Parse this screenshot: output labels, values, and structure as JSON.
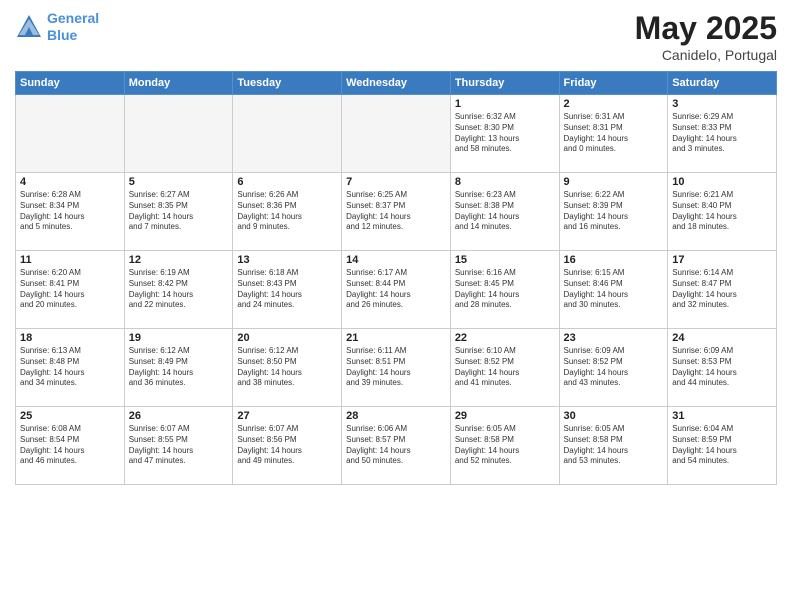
{
  "header": {
    "logo_line1": "General",
    "logo_line2": "Blue",
    "title": "May 2025",
    "subtitle": "Canidelo, Portugal"
  },
  "weekdays": [
    "Sunday",
    "Monday",
    "Tuesday",
    "Wednesday",
    "Thursday",
    "Friday",
    "Saturday"
  ],
  "weeks": [
    [
      {
        "day": "",
        "empty": true
      },
      {
        "day": "",
        "empty": true
      },
      {
        "day": "",
        "empty": true
      },
      {
        "day": "",
        "empty": true
      },
      {
        "day": "1",
        "lines": [
          "Sunrise: 6:32 AM",
          "Sunset: 8:30 PM",
          "Daylight: 13 hours",
          "and 58 minutes."
        ]
      },
      {
        "day": "2",
        "lines": [
          "Sunrise: 6:31 AM",
          "Sunset: 8:31 PM",
          "Daylight: 14 hours",
          "and 0 minutes."
        ]
      },
      {
        "day": "3",
        "lines": [
          "Sunrise: 6:29 AM",
          "Sunset: 8:33 PM",
          "Daylight: 14 hours",
          "and 3 minutes."
        ]
      }
    ],
    [
      {
        "day": "4",
        "lines": [
          "Sunrise: 6:28 AM",
          "Sunset: 8:34 PM",
          "Daylight: 14 hours",
          "and 5 minutes."
        ]
      },
      {
        "day": "5",
        "lines": [
          "Sunrise: 6:27 AM",
          "Sunset: 8:35 PM",
          "Daylight: 14 hours",
          "and 7 minutes."
        ]
      },
      {
        "day": "6",
        "lines": [
          "Sunrise: 6:26 AM",
          "Sunset: 8:36 PM",
          "Daylight: 14 hours",
          "and 9 minutes."
        ]
      },
      {
        "day": "7",
        "lines": [
          "Sunrise: 6:25 AM",
          "Sunset: 8:37 PM",
          "Daylight: 14 hours",
          "and 12 minutes."
        ]
      },
      {
        "day": "8",
        "lines": [
          "Sunrise: 6:23 AM",
          "Sunset: 8:38 PM",
          "Daylight: 14 hours",
          "and 14 minutes."
        ]
      },
      {
        "day": "9",
        "lines": [
          "Sunrise: 6:22 AM",
          "Sunset: 8:39 PM",
          "Daylight: 14 hours",
          "and 16 minutes."
        ]
      },
      {
        "day": "10",
        "lines": [
          "Sunrise: 6:21 AM",
          "Sunset: 8:40 PM",
          "Daylight: 14 hours",
          "and 18 minutes."
        ]
      }
    ],
    [
      {
        "day": "11",
        "lines": [
          "Sunrise: 6:20 AM",
          "Sunset: 8:41 PM",
          "Daylight: 14 hours",
          "and 20 minutes."
        ]
      },
      {
        "day": "12",
        "lines": [
          "Sunrise: 6:19 AM",
          "Sunset: 8:42 PM",
          "Daylight: 14 hours",
          "and 22 minutes."
        ]
      },
      {
        "day": "13",
        "lines": [
          "Sunrise: 6:18 AM",
          "Sunset: 8:43 PM",
          "Daylight: 14 hours",
          "and 24 minutes."
        ]
      },
      {
        "day": "14",
        "lines": [
          "Sunrise: 6:17 AM",
          "Sunset: 8:44 PM",
          "Daylight: 14 hours",
          "and 26 minutes."
        ]
      },
      {
        "day": "15",
        "lines": [
          "Sunrise: 6:16 AM",
          "Sunset: 8:45 PM",
          "Daylight: 14 hours",
          "and 28 minutes."
        ]
      },
      {
        "day": "16",
        "lines": [
          "Sunrise: 6:15 AM",
          "Sunset: 8:46 PM",
          "Daylight: 14 hours",
          "and 30 minutes."
        ]
      },
      {
        "day": "17",
        "lines": [
          "Sunrise: 6:14 AM",
          "Sunset: 8:47 PM",
          "Daylight: 14 hours",
          "and 32 minutes."
        ]
      }
    ],
    [
      {
        "day": "18",
        "lines": [
          "Sunrise: 6:13 AM",
          "Sunset: 8:48 PM",
          "Daylight: 14 hours",
          "and 34 minutes."
        ]
      },
      {
        "day": "19",
        "lines": [
          "Sunrise: 6:12 AM",
          "Sunset: 8:49 PM",
          "Daylight: 14 hours",
          "and 36 minutes."
        ]
      },
      {
        "day": "20",
        "lines": [
          "Sunrise: 6:12 AM",
          "Sunset: 8:50 PM",
          "Daylight: 14 hours",
          "and 38 minutes."
        ]
      },
      {
        "day": "21",
        "lines": [
          "Sunrise: 6:11 AM",
          "Sunset: 8:51 PM",
          "Daylight: 14 hours",
          "and 39 minutes."
        ]
      },
      {
        "day": "22",
        "lines": [
          "Sunrise: 6:10 AM",
          "Sunset: 8:52 PM",
          "Daylight: 14 hours",
          "and 41 minutes."
        ]
      },
      {
        "day": "23",
        "lines": [
          "Sunrise: 6:09 AM",
          "Sunset: 8:52 PM",
          "Daylight: 14 hours",
          "and 43 minutes."
        ]
      },
      {
        "day": "24",
        "lines": [
          "Sunrise: 6:09 AM",
          "Sunset: 8:53 PM",
          "Daylight: 14 hours",
          "and 44 minutes."
        ]
      }
    ],
    [
      {
        "day": "25",
        "lines": [
          "Sunrise: 6:08 AM",
          "Sunset: 8:54 PM",
          "Daylight: 14 hours",
          "and 46 minutes."
        ]
      },
      {
        "day": "26",
        "lines": [
          "Sunrise: 6:07 AM",
          "Sunset: 8:55 PM",
          "Daylight: 14 hours",
          "and 47 minutes."
        ]
      },
      {
        "day": "27",
        "lines": [
          "Sunrise: 6:07 AM",
          "Sunset: 8:56 PM",
          "Daylight: 14 hours",
          "and 49 minutes."
        ]
      },
      {
        "day": "28",
        "lines": [
          "Sunrise: 6:06 AM",
          "Sunset: 8:57 PM",
          "Daylight: 14 hours",
          "and 50 minutes."
        ]
      },
      {
        "day": "29",
        "lines": [
          "Sunrise: 6:05 AM",
          "Sunset: 8:58 PM",
          "Daylight: 14 hours",
          "and 52 minutes."
        ]
      },
      {
        "day": "30",
        "lines": [
          "Sunrise: 6:05 AM",
          "Sunset: 8:58 PM",
          "Daylight: 14 hours",
          "and 53 minutes."
        ]
      },
      {
        "day": "31",
        "lines": [
          "Sunrise: 6:04 AM",
          "Sunset: 8:59 PM",
          "Daylight: 14 hours",
          "and 54 minutes."
        ]
      }
    ]
  ]
}
